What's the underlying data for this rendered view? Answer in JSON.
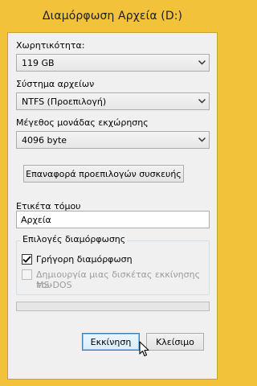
{
  "window": {
    "title": "Διαμόρφωση Αρχεία (D:)"
  },
  "capacity": {
    "label": "Χωρητικότητα:",
    "value": "119 GB"
  },
  "file_system": {
    "label": "Σύστημα αρχείων",
    "value": "NTFS  (Προεπιλογή)"
  },
  "allocation_unit": {
    "label": "Μέγεθος μονάδας εκχώρησης",
    "value": "4096 byte"
  },
  "restore_defaults_button": "Επαναφορά προεπιλογών συσκευής",
  "volume_label": {
    "label": "Ετικέτα τόμου",
    "value": "Αρχεία"
  },
  "format_options": {
    "legend": "Επιλογές διαμόρφωσης",
    "quick_format": {
      "label": "Γρήγορη διαμόρφωση",
      "checked": true
    },
    "msdos_disk": {
      "label_line1": "Δημιουργία μιας δισκέτας εκκίνησης του",
      "label_line2": "MS-DOS",
      "checked": false,
      "disabled": true
    }
  },
  "progress": {
    "value": 0
  },
  "buttons": {
    "start": "Εκκίνηση",
    "close": "Κλείσιμο"
  },
  "colors": {
    "frame": "#f2c23a",
    "client": "#f0f0f0",
    "default_button_border": "#3c7fb1"
  }
}
